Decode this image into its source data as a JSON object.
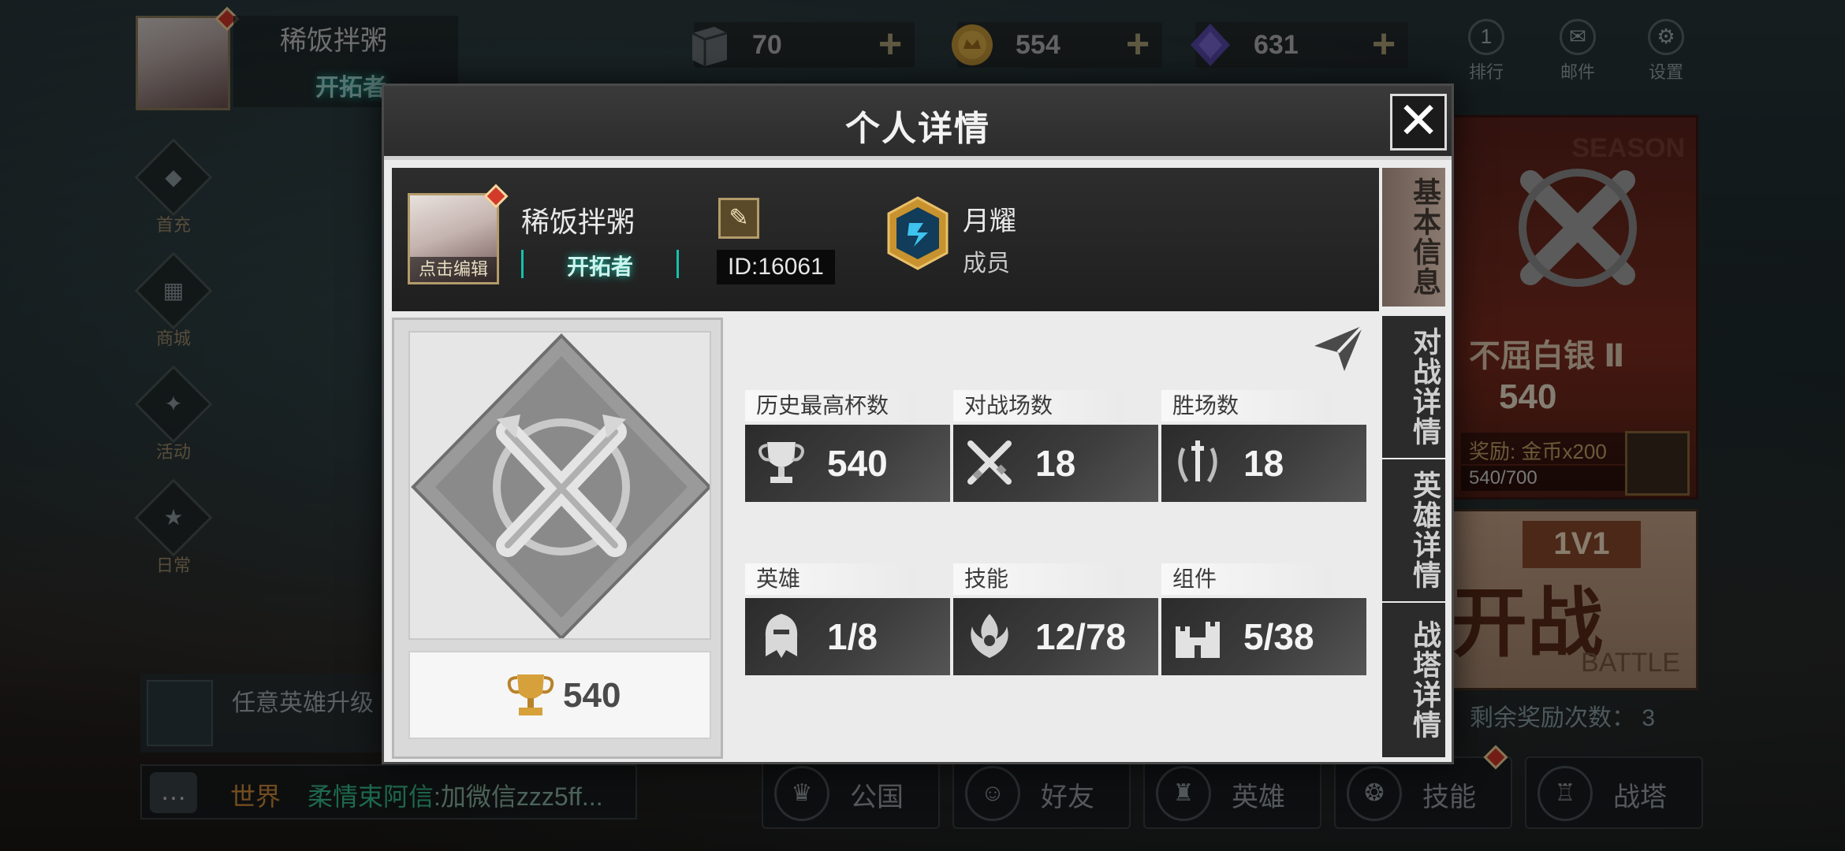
{
  "topbar": {
    "player_name": "稀饭拌粥",
    "player_title": "开拓者",
    "resources": [
      {
        "icon": "book-icon",
        "value": "70"
      },
      {
        "icon": "gold-coin-icon",
        "value": "554"
      },
      {
        "icon": "purple-gem-icon",
        "value": "631"
      }
    ],
    "plus_label": "+",
    "buttons": [
      {
        "label": "排行",
        "icon": "rank-icon",
        "glyph": "1"
      },
      {
        "label": "邮件",
        "icon": "mail-icon",
        "glyph": "✉"
      },
      {
        "label": "设置",
        "icon": "gear-icon",
        "glyph": "⚙"
      }
    ]
  },
  "left_menu": [
    {
      "label": "首充",
      "icon": "first-charge-icon",
      "glyph": "◆"
    },
    {
      "label": "商城",
      "icon": "shop-icon",
      "glyph": "▦"
    },
    {
      "label": "活动",
      "icon": "event-icon",
      "glyph": "✦"
    },
    {
      "label": "日常",
      "icon": "daily-icon",
      "glyph": "★"
    }
  ],
  "quest": {
    "text": "任意英雄升级"
  },
  "chat": {
    "channel": "世界",
    "sender": "柔情束阿信",
    "message": ":加微信zzz5ff..."
  },
  "season": {
    "label": "SEASON",
    "rank_name": "不屈白银 Ⅱ",
    "cups": "540",
    "reward": "奖励: 金币x200",
    "progress": "540/700"
  },
  "battle": {
    "mode": "1V1",
    "label": "开战",
    "en": "BATTLE"
  },
  "remain": "剩余奖励次数： 3",
  "bottom_nav": [
    {
      "label": "公国",
      "icon": "crown-icon",
      "glyph": "♛"
    },
    {
      "label": "好友",
      "icon": "friends-icon",
      "glyph": "☺"
    },
    {
      "label": "英雄",
      "icon": "hero-icon",
      "glyph": "♜"
    },
    {
      "label": "技能",
      "icon": "skill-icon",
      "glyph": "❂"
    },
    {
      "label": "战塔",
      "icon": "tower-icon",
      "glyph": "♖"
    }
  ],
  "modal": {
    "title": "个人详情",
    "close_label": "✕",
    "profile": {
      "name": "稀饭拌粥",
      "title": "开拓者",
      "avatar_edit": "点击编辑",
      "id": "ID:16061",
      "guild_name": "月耀",
      "guild_role": "成员"
    },
    "tabs": [
      {
        "label": "基本信息",
        "active": true
      },
      {
        "label": "对战详情",
        "active": false
      },
      {
        "label": "英雄详情",
        "active": false
      },
      {
        "label": "战塔详情",
        "active": false
      }
    ],
    "rank_cups": "540",
    "stats": [
      {
        "label": "历史最高杯数",
        "value": "540",
        "icon": "trophy-icon"
      },
      {
        "label": "对战场数",
        "value": "18",
        "icon": "crossed-swords-icon"
      },
      {
        "label": "胜场数",
        "value": "18",
        "icon": "laurel-sword-icon"
      },
      {
        "label": "英雄",
        "value": "1/8",
        "icon": "helmet-icon"
      },
      {
        "label": "技能",
        "value": "12/78",
        "icon": "flame-emblem-icon"
      },
      {
        "label": "组件",
        "value": "5/38",
        "icon": "castle-icon"
      }
    ]
  },
  "colors": {
    "accent_teal": "#17c0aa",
    "badge_red": "#d23a2a",
    "chat_green": "#37c08e",
    "season_red": "#7e2d20"
  }
}
